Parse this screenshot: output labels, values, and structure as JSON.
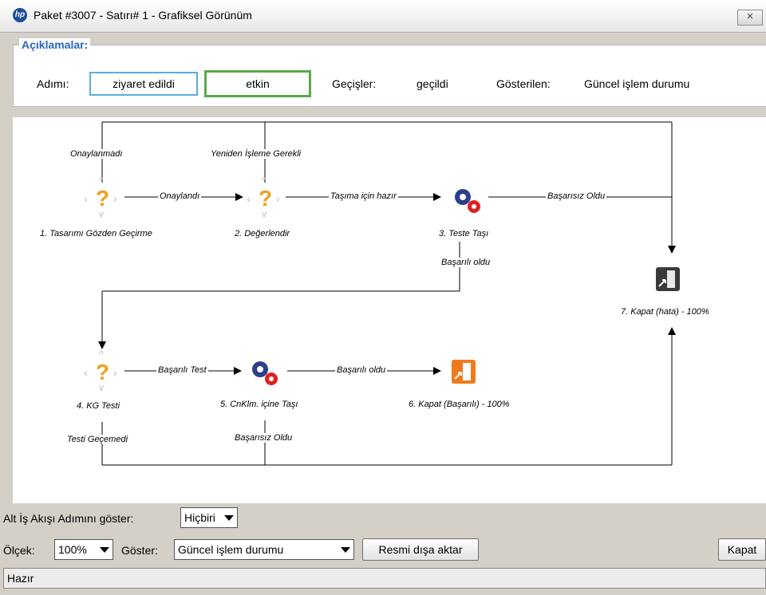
{
  "window": {
    "title": "Paket #3007 - Satırı# 1 - Grafiksel Görünüm",
    "close_glyph": "✕"
  },
  "legend": {
    "title": "Açıklamalar:",
    "step_label": "Adımı:",
    "visited": "ziyaret edildi",
    "active": "etkin",
    "transitions_label": "Geçişler:",
    "transitions_value": "geçildi",
    "shown_label": "Gösterilen:",
    "shown_value": "Güncel işlem durumu"
  },
  "workflow": {
    "steps": [
      {
        "label": "1. Tasarımı Gözden Geçirme",
        "icon": "question-icon"
      },
      {
        "label": "2. Değerlendir",
        "icon": "question-icon"
      },
      {
        "label": "3. Teste Taşı",
        "icon": "gear-icon"
      },
      {
        "label": "4. KG Testi",
        "icon": "question-icon"
      },
      {
        "label": "5. CnKlm. içine Taşı",
        "icon": "gear-icon"
      },
      {
        "label": "6. Kapat (Başarılı) - 100%",
        "icon": "exit-icon-orange"
      },
      {
        "label": "7. Kapat (hata) - 100%",
        "icon": "exit-icon-dark"
      }
    ],
    "transitions": {
      "t1_approved": "Onaylandı",
      "t1_rejected": "Onaylanmadı",
      "t2_ready": "Taşıma için hazır",
      "t2_rework": "Yeniden İşleme Gerekli",
      "t3_fail": "Başarısız Oldu",
      "t3_success": "Başarılı oldu",
      "t4_pass": "Başarılı Test",
      "t4_fail": "Testi Geçemedi",
      "t5_success": "Başarılı oldu",
      "t5_fail": "Başarısız Oldu"
    },
    "colors": {
      "question": "#f0a020",
      "gear_blue": "#2b3f8c",
      "gear_red": "#e02020",
      "exit_orange": "#f07a20",
      "exit_dark": "#3a3a3a"
    }
  },
  "controls": {
    "subflow_label": "Alt İş Akışı Adımını göster:",
    "subflow_value": "Hiçbiri",
    "scale_label": "Ölçek:",
    "scale_value": "100%",
    "show_label": "Göster:",
    "show_value": "Güncel işlem durumu",
    "export_button": "Resmi dışa aktar",
    "close_button": "Kapat"
  },
  "status": {
    "text": "Hazır"
  }
}
